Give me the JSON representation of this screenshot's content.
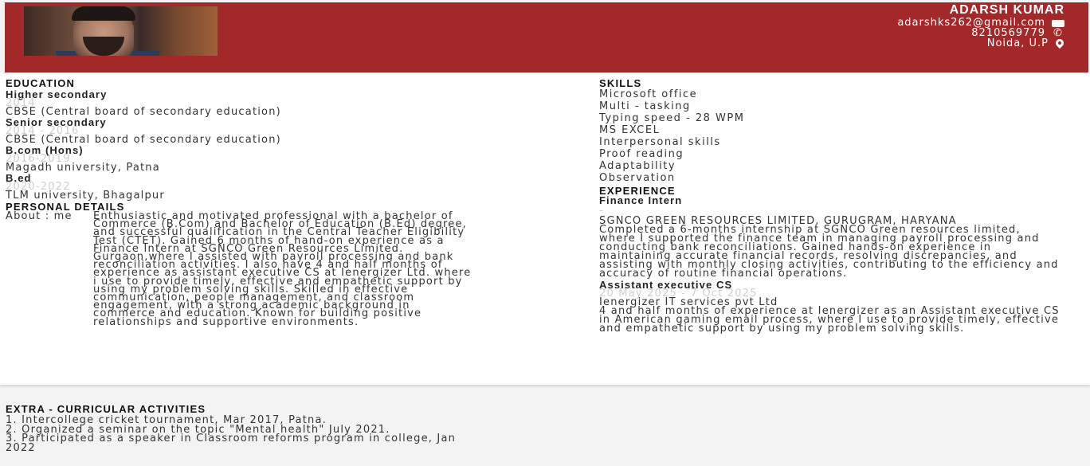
{
  "header": {
    "name": "ADARSH KUMAR",
    "email": "adarshks262@gmail.com",
    "phone": "8210569779",
    "location": "Noida, U.P",
    "icons": [
      "mail-icon",
      "phone-icon",
      "location-pin-icon"
    ],
    "accent_color": "#a3282a"
  },
  "education": {
    "title": "EDUCATION",
    "items": [
      {
        "degree": "Higher secondary",
        "date": "2014",
        "institution": "CBSE (Central board of secondary education)"
      },
      {
        "degree": "Senior secondary",
        "date": "2014 - 2016",
        "institution": "CBSE (Central board of secondary education)"
      },
      {
        "degree": "B.com (Hons)",
        "date": "2016-2019",
        "institution": "Magadh university, Patna"
      },
      {
        "degree": "B.ed",
        "date": "2020-2022",
        "institution": "TLM university, Bhagalpur"
      }
    ]
  },
  "personal": {
    "title": "PERSONAL DETAILS",
    "about_label": "About : me",
    "about_text": "Enthusiastic and motivated professional with a bachelor of Commerce (B.Com) and Bachelor of Education (B.Ed) degree, and successful qualification in the Central Teacher Eligibility Test (CTET). Gained 6 months of hand-on experience as a Finance Intern at SGNCO Green Resources Limited. Gurgaon,where I assisted with payroll processing and bank reconciliation activities. I also have 4 and half months of experience as assistant executive CS at Ienergizer Ltd. where i use to provide timely, effective and empathetic support by using my problem solving skills. Skilled in effective communication, people management, and classroom engagement, with a strong academic background in commerce and education. Known for building positive relationships and supportive environments."
  },
  "skills": {
    "title": "SKILLS",
    "items": [
      "Microsoft office",
      "Multi - tasking",
      "Typing speed - 28 WPM",
      "MS EXCEL",
      "Interpersonal skills",
      "Proof reading",
      "Adaptability",
      "Observation"
    ]
  },
  "experience": {
    "title": "EXPERIENCE",
    "items": [
      {
        "role": "Finance Intern",
        "date": "-",
        "company": "SGNCO GREEN RESOURCES LIMITED, GURUGRAM, HARYANA",
        "description": "Completed a 6-months internship at SGNCO Green resources limited, where I supported the finance team in managing payroll processing and conducting bank reconciliations. Gained hands-on experience in maintaining accurate financial records, resolving discrepancies, and assisting with monthly closing activities, contributing to the efficiency and accuracy of routine financial operations."
      },
      {
        "role": "Assistant executive CS",
        "date": "20 May 2025 - 7 Oct 2025",
        "company": "Ienergizer IT services pvt Ltd",
        "description": "4 and half months of experience at Ienergizer as an Assistant executive CS in American gaming email process, where I use to provide timely, effective and empathetic support by using my problem solving skills."
      }
    ]
  },
  "extra": {
    "title": "EXTRA - CURRICULAR ACTIVITIES",
    "items": [
      "1. Intercollege cricket tournament, Mar 2017, Patna.",
      "2. Organized a seminar on the topic \"Mental health\" July 2021.",
      "3. Participated as a speaker in Classroom reforms program in college, Jan 2022"
    ]
  }
}
